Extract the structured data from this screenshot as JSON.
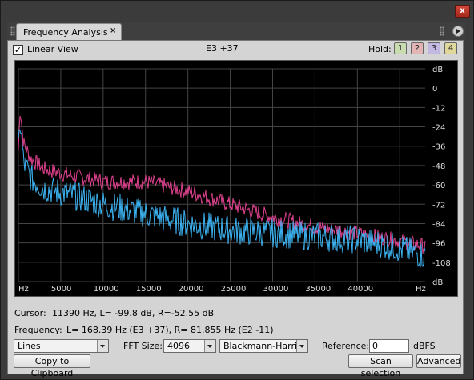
{
  "window": {
    "close_glyph": "x"
  },
  "tab": {
    "title": "Frequency Analysis",
    "close_glyph": "×"
  },
  "toolbar": {
    "linear_view_label": "Linear View",
    "linear_view_checked": true,
    "note_readout": "E3 +37",
    "hold_label": "Hold:",
    "hold_buttons": [
      {
        "label": "1",
        "color": "#c8dcb0"
      },
      {
        "label": "2",
        "color": "#e2b4b4"
      },
      {
        "label": "3",
        "color": "#c2b8e2"
      },
      {
        "label": "4",
        "color": "#e0d89a"
      }
    ]
  },
  "chart_data": {
    "type": "line",
    "x_unit_label": "Hz",
    "y_unit_label": "dB",
    "x_ticks": [
      "Hz",
      "5000",
      "10000",
      "15000",
      "20000",
      "25000",
      "30000",
      "35000",
      "40000",
      "Hz"
    ],
    "y_ticks": [
      "dB",
      "0",
      "-12",
      "-24",
      "-36",
      "-48",
      "-60",
      "-72",
      "-84",
      "-96",
      "-108",
      "dB"
    ],
    "xlim": [
      0,
      48000
    ],
    "ylim": [
      -120,
      12
    ],
    "grid": true,
    "series": [
      {
        "color": "#e0428f",
        "x": [
          0,
          200,
          600,
          1500,
          3000,
          6000,
          10000,
          15000,
          20000,
          25000,
          30000,
          35000,
          40000,
          44000,
          48000
        ],
        "y": [
          -38,
          -12,
          -34,
          -44,
          -50,
          -54,
          -58,
          -58,
          -64,
          -72,
          -80,
          -86,
          -90,
          -94,
          -98
        ]
      },
      {
        "color": "#3cb2f0",
        "x": [
          0,
          200,
          600,
          1500,
          3000,
          6000,
          10000,
          15000,
          20000,
          25000,
          30000,
          35000,
          40000,
          44000,
          48000
        ],
        "y": [
          -40,
          -20,
          -46,
          -56,
          -62,
          -66,
          -72,
          -78,
          -84,
          -88,
          -90,
          -92,
          -94,
          -98,
          -104
        ]
      }
    ],
    "colors": {
      "left": "#e0428f",
      "right": "#3cb2f0",
      "grid": "#444444",
      "background": "#000000",
      "axis_text": "#dddddd"
    }
  },
  "readout": {
    "cursor_label": "Cursor:",
    "cursor_value": "11390 Hz, L= -99.8 dB, R=-52.55 dB",
    "frequency_label": "Frequency:",
    "frequency_value": "L= 168.39 Hz (E3 +37), R= 81.855 Hz (E2 -11)"
  },
  "controls": {
    "display_mode": "Lines",
    "fft_size_label": "FFT Size:",
    "fft_size": "4096",
    "window_function": "Blackmann-Harris",
    "reference_label": "Reference:",
    "reference_value": "0",
    "reference_unit": "dBFS",
    "copy_button": "Copy to Clipboard",
    "scan_button": "Scan selection",
    "advanced_button": "Advanced"
  }
}
